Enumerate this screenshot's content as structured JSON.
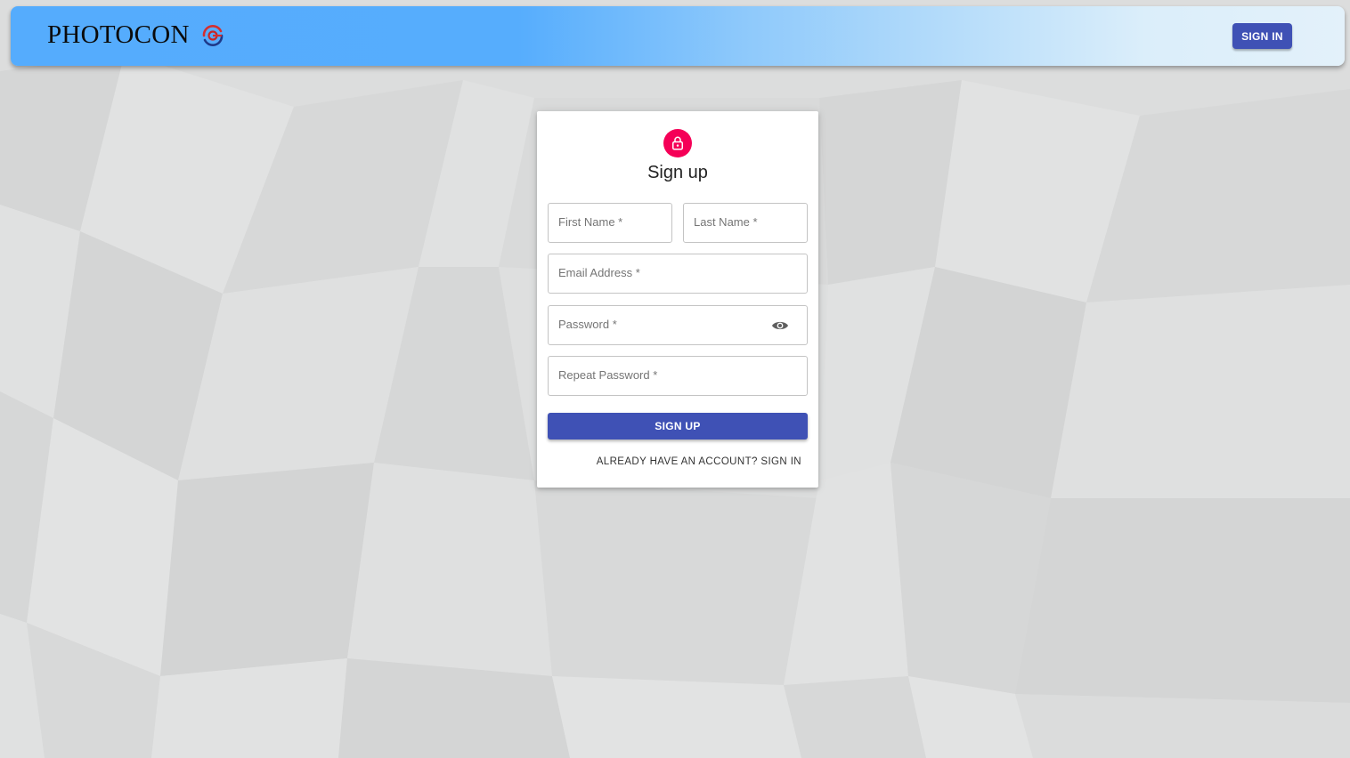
{
  "header": {
    "brand": "PHOTOCON",
    "logo_icon": "photocon-logo-icon",
    "signin_label": "SIGN IN"
  },
  "form": {
    "title": "Sign up",
    "lock_icon": "lock-icon",
    "first_name_placeholder": "First Name *",
    "last_name_placeholder": "Last Name *",
    "email_placeholder": "Email Address *",
    "password_placeholder": "Password *",
    "repeat_password_placeholder": "Repeat Password *",
    "visibility_icon": "eye-icon",
    "submit_label": "SIGN UP",
    "signin_link": "ALREADY HAVE AN ACCOUNT? SIGN IN"
  },
  "colors": {
    "primary": "#3f51b5",
    "accent": "#f50057",
    "header_start": "#55acfd",
    "header_end": "#e3f1fa",
    "background": "#dcdddd"
  }
}
